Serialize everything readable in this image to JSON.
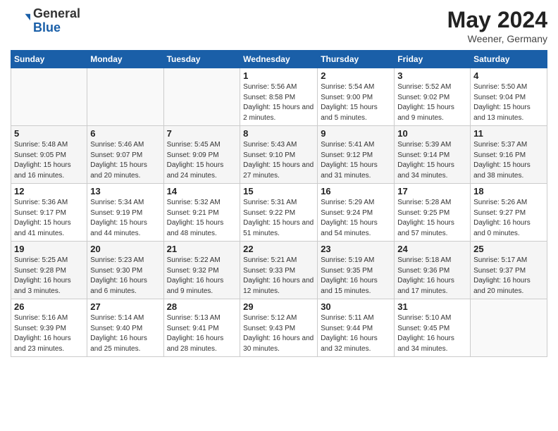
{
  "header": {
    "logo_general": "General",
    "logo_blue": "Blue",
    "month_title": "May 2024",
    "location": "Weener, Germany"
  },
  "days_of_week": [
    "Sunday",
    "Monday",
    "Tuesday",
    "Wednesday",
    "Thursday",
    "Friday",
    "Saturday"
  ],
  "weeks": [
    [
      {
        "day": "",
        "info": ""
      },
      {
        "day": "",
        "info": ""
      },
      {
        "day": "",
        "info": ""
      },
      {
        "day": "1",
        "info": "Sunrise: 5:56 AM\nSunset: 8:58 PM\nDaylight: 15 hours\nand 2 minutes."
      },
      {
        "day": "2",
        "info": "Sunrise: 5:54 AM\nSunset: 9:00 PM\nDaylight: 15 hours\nand 5 minutes."
      },
      {
        "day": "3",
        "info": "Sunrise: 5:52 AM\nSunset: 9:02 PM\nDaylight: 15 hours\nand 9 minutes."
      },
      {
        "day": "4",
        "info": "Sunrise: 5:50 AM\nSunset: 9:04 PM\nDaylight: 15 hours\nand 13 minutes."
      }
    ],
    [
      {
        "day": "5",
        "info": "Sunrise: 5:48 AM\nSunset: 9:05 PM\nDaylight: 15 hours\nand 16 minutes."
      },
      {
        "day": "6",
        "info": "Sunrise: 5:46 AM\nSunset: 9:07 PM\nDaylight: 15 hours\nand 20 minutes."
      },
      {
        "day": "7",
        "info": "Sunrise: 5:45 AM\nSunset: 9:09 PM\nDaylight: 15 hours\nand 24 minutes."
      },
      {
        "day": "8",
        "info": "Sunrise: 5:43 AM\nSunset: 9:10 PM\nDaylight: 15 hours\nand 27 minutes."
      },
      {
        "day": "9",
        "info": "Sunrise: 5:41 AM\nSunset: 9:12 PM\nDaylight: 15 hours\nand 31 minutes."
      },
      {
        "day": "10",
        "info": "Sunrise: 5:39 AM\nSunset: 9:14 PM\nDaylight: 15 hours\nand 34 minutes."
      },
      {
        "day": "11",
        "info": "Sunrise: 5:37 AM\nSunset: 9:16 PM\nDaylight: 15 hours\nand 38 minutes."
      }
    ],
    [
      {
        "day": "12",
        "info": "Sunrise: 5:36 AM\nSunset: 9:17 PM\nDaylight: 15 hours\nand 41 minutes."
      },
      {
        "day": "13",
        "info": "Sunrise: 5:34 AM\nSunset: 9:19 PM\nDaylight: 15 hours\nand 44 minutes."
      },
      {
        "day": "14",
        "info": "Sunrise: 5:32 AM\nSunset: 9:21 PM\nDaylight: 15 hours\nand 48 minutes."
      },
      {
        "day": "15",
        "info": "Sunrise: 5:31 AM\nSunset: 9:22 PM\nDaylight: 15 hours\nand 51 minutes."
      },
      {
        "day": "16",
        "info": "Sunrise: 5:29 AM\nSunset: 9:24 PM\nDaylight: 15 hours\nand 54 minutes."
      },
      {
        "day": "17",
        "info": "Sunrise: 5:28 AM\nSunset: 9:25 PM\nDaylight: 15 hours\nand 57 minutes."
      },
      {
        "day": "18",
        "info": "Sunrise: 5:26 AM\nSunset: 9:27 PM\nDaylight: 16 hours\nand 0 minutes."
      }
    ],
    [
      {
        "day": "19",
        "info": "Sunrise: 5:25 AM\nSunset: 9:28 PM\nDaylight: 16 hours\nand 3 minutes."
      },
      {
        "day": "20",
        "info": "Sunrise: 5:23 AM\nSunset: 9:30 PM\nDaylight: 16 hours\nand 6 minutes."
      },
      {
        "day": "21",
        "info": "Sunrise: 5:22 AM\nSunset: 9:32 PM\nDaylight: 16 hours\nand 9 minutes."
      },
      {
        "day": "22",
        "info": "Sunrise: 5:21 AM\nSunset: 9:33 PM\nDaylight: 16 hours\nand 12 minutes."
      },
      {
        "day": "23",
        "info": "Sunrise: 5:19 AM\nSunset: 9:35 PM\nDaylight: 16 hours\nand 15 minutes."
      },
      {
        "day": "24",
        "info": "Sunrise: 5:18 AM\nSunset: 9:36 PM\nDaylight: 16 hours\nand 17 minutes."
      },
      {
        "day": "25",
        "info": "Sunrise: 5:17 AM\nSunset: 9:37 PM\nDaylight: 16 hours\nand 20 minutes."
      }
    ],
    [
      {
        "day": "26",
        "info": "Sunrise: 5:16 AM\nSunset: 9:39 PM\nDaylight: 16 hours\nand 23 minutes."
      },
      {
        "day": "27",
        "info": "Sunrise: 5:14 AM\nSunset: 9:40 PM\nDaylight: 16 hours\nand 25 minutes."
      },
      {
        "day": "28",
        "info": "Sunrise: 5:13 AM\nSunset: 9:41 PM\nDaylight: 16 hours\nand 28 minutes."
      },
      {
        "day": "29",
        "info": "Sunrise: 5:12 AM\nSunset: 9:43 PM\nDaylight: 16 hours\nand 30 minutes."
      },
      {
        "day": "30",
        "info": "Sunrise: 5:11 AM\nSunset: 9:44 PM\nDaylight: 16 hours\nand 32 minutes."
      },
      {
        "day": "31",
        "info": "Sunrise: 5:10 AM\nSunset: 9:45 PM\nDaylight: 16 hours\nand 34 minutes."
      },
      {
        "day": "",
        "info": ""
      }
    ]
  ]
}
